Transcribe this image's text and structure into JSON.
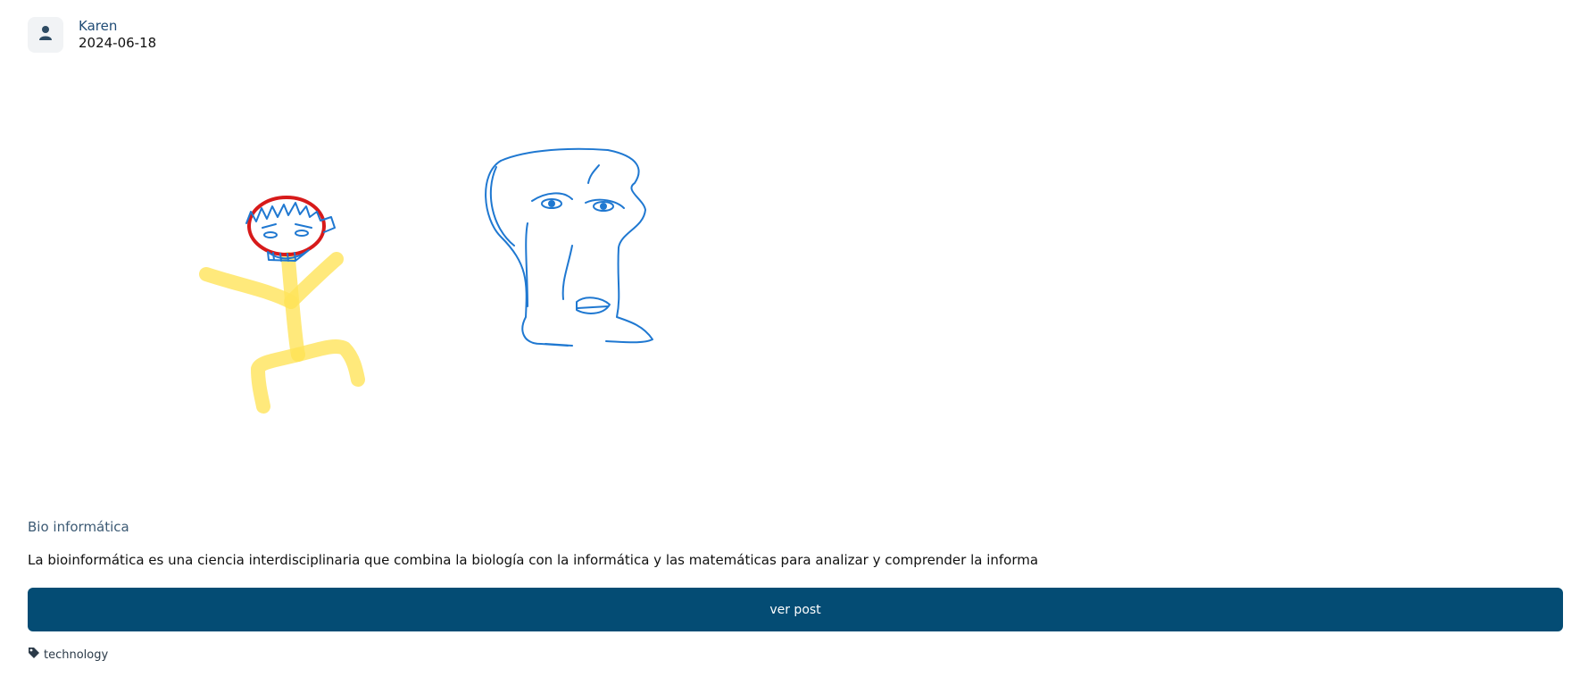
{
  "post": {
    "author": "Karen",
    "date": "2024-06-18",
    "title": "Bio informática",
    "excerpt": "La bioinformática es una ciencia interdisciplinaria que combina la biología con la informática y las matemáticas para analizar y comprender la informa",
    "button_label": "ver post",
    "tag": "technology"
  },
  "icons": {
    "avatar": "user-icon",
    "tag": "tag-icon"
  },
  "colors": {
    "button": "#044c74",
    "author_name": "#1f4b75",
    "title": "#3c5a74",
    "sketch_blue": "#1f78d1",
    "sketch_red": "#d71a1a",
    "sketch_yellow": "#ffe45a"
  }
}
